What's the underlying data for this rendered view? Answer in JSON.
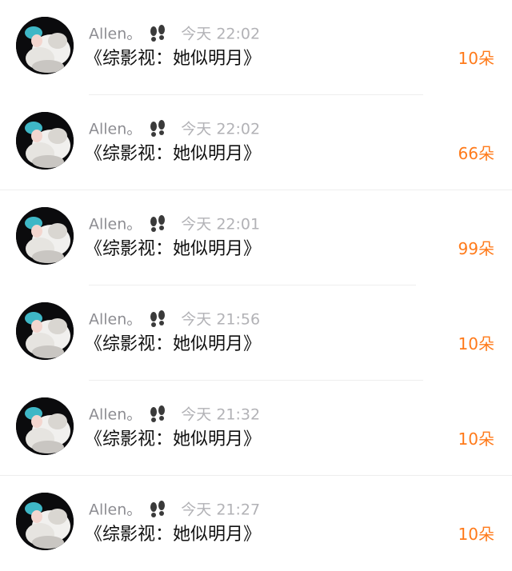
{
  "colors": {
    "username": "#8e8e93",
    "time": "#b2b2b6",
    "title": "#111111",
    "count": "#ff7a1a",
    "divider": "#eeeeee"
  },
  "gift_list": [
    {
      "username": "Allen。",
      "badge_icon": "footprints-icon",
      "time": "今天 22:02",
      "title": "《综影视：她似明月》",
      "count": "10朵"
    },
    {
      "username": "Allen。",
      "badge_icon": "footprints-icon",
      "time": "今天 22:02",
      "title": "《综影视：她似明月》",
      "count": "66朵"
    },
    {
      "username": "Allen。",
      "badge_icon": "footprints-icon",
      "time": "今天 22:01",
      "title": "《综影视：她似明月》",
      "count": "99朵"
    },
    {
      "username": "Allen。",
      "badge_icon": "footprints-icon",
      "time": "今天 21:56",
      "title": "《综影视：她似明月》",
      "count": "10朵"
    },
    {
      "username": "Allen。",
      "badge_icon": "footprints-icon",
      "time": "今天 21:32",
      "title": "《综影视：她似明月》",
      "count": "10朵"
    },
    {
      "username": "Allen。",
      "badge_icon": "footprints-icon",
      "time": "今天 21:27",
      "title": "《综影视：她似明月》",
      "count": "10朵"
    }
  ]
}
